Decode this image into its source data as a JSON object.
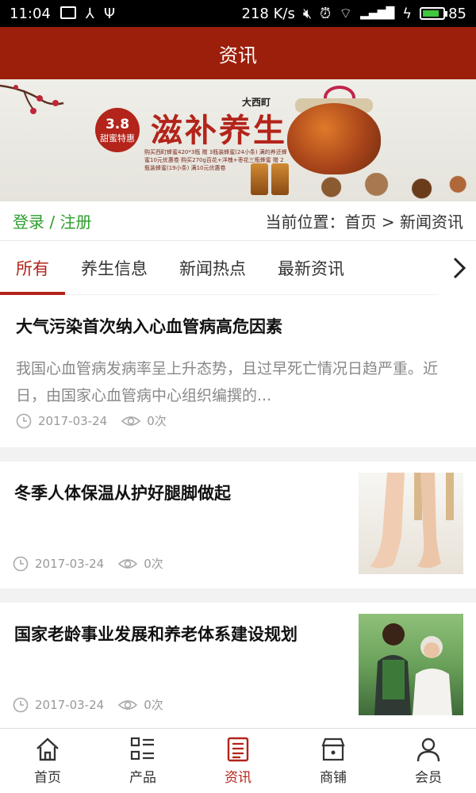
{
  "status_bar": {
    "time": "11:04",
    "speed": "218 K/s",
    "battery": "85"
  },
  "header": {
    "title": "资讯"
  },
  "banner": {
    "badge_big": "3.8",
    "badge_small": "甜蜜特惠",
    "title": "滋补养生",
    "brand": "大西町",
    "promo_text": "购买西町蜂蜜420*3瓶 赠 3瓶装蜂蜜(24小条) 满的养还蜂蜜10元优惠卷 购买270g百花+洋槐+枣花三瓶蜂蜜 赠 2瓶装蜂蜜(19小条) 满10元优惠卷"
  },
  "location_bar": {
    "login_label": "登录 / 注册",
    "location_label": "当前位置：首页 > 新闻资讯"
  },
  "tabs": [
    {
      "label": "所有"
    },
    {
      "label": "养生信息"
    },
    {
      "label": "新闻热点"
    },
    {
      "label": "最新资讯"
    }
  ],
  "news": [
    {
      "title": "大气污染首次纳入心血管病高危因素",
      "desc": " 我国心血管病发病率呈上升态势，且过早死亡情况日趋严重。近日，由国家心血管病中心组织编撰的...",
      "date": "2017-03-24",
      "views": "0次"
    },
    {
      "title": "冬季人体保温从护好腿脚做起",
      "date": "2017-03-24",
      "views": "0次"
    },
    {
      "title": "国家老龄事业发展和养老体系建设规划",
      "date": "2017-03-24",
      "views": "0次"
    }
  ],
  "bottom_nav": [
    {
      "label": "首页",
      "icon": "home-icon"
    },
    {
      "label": "产品",
      "icon": "grid-list-icon"
    },
    {
      "label": "资讯",
      "icon": "news-icon"
    },
    {
      "label": "商铺",
      "icon": "shop-icon"
    },
    {
      "label": "会员",
      "icon": "user-icon"
    }
  ],
  "colors": {
    "brand": "#9c1f0b",
    "accent": "#b3241a",
    "login_green": "#2d9d2d"
  }
}
